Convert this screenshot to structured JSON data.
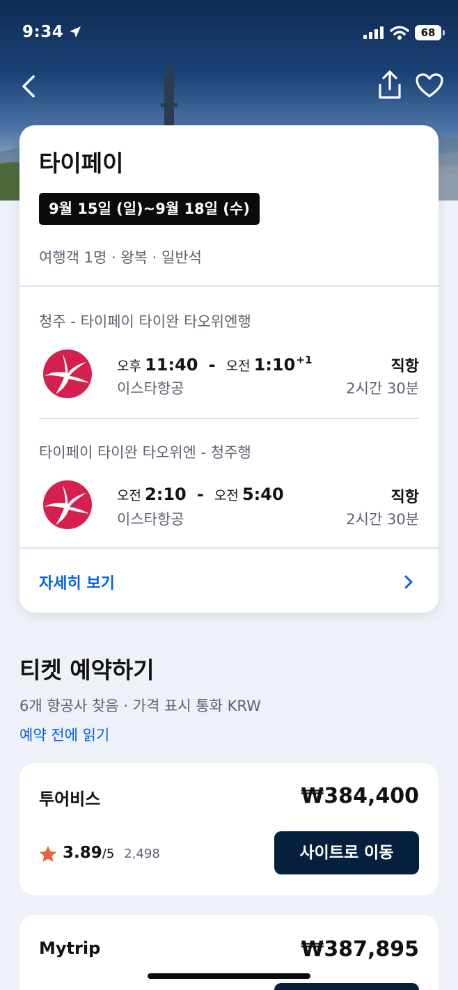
{
  "status_bar": {
    "time": "9:34",
    "battery": "68"
  },
  "trip": {
    "title": "타이페이",
    "dates": "9월 15일 (일)~9월 18일 (수)",
    "meta": "여행객 1명 · 왕복 · 일반석",
    "legs": [
      {
        "route": "청주 - 타이페이 타이완 타오위엔행",
        "dep_ampm": "오후",
        "dep_time": "11:40",
        "arr_ampm": "오전",
        "arr_time": "1:10",
        "arr_day_offset": "+1",
        "separator": "-",
        "airline": "이스타항공",
        "stops": "직항",
        "duration": "2시간 30분"
      },
      {
        "route": "타이페이 타이완 타오위엔 - 청주행",
        "dep_ampm": "오전",
        "dep_time": "2:10",
        "arr_ampm": "오전",
        "arr_time": "5:40",
        "arr_day_offset": "",
        "separator": "-",
        "airline": "이스타항공",
        "stops": "직항",
        "duration": "2시간 30분"
      }
    ],
    "details_label": "자세히 보기"
  },
  "booking": {
    "title": "티켓 예약하기",
    "meta": "6개 항공사 찾음 · 가격 표시 통화 KRW",
    "read_link": "예약 전에 읽기",
    "offers": [
      {
        "name": "투어비스",
        "price": "₩384,400",
        "rating": "3.89",
        "rating_max": "/5",
        "reviews": "2,498",
        "button": "사이트로 이동"
      },
      {
        "name": "Mytrip",
        "price": "₩387,895"
      }
    ]
  },
  "colors": {
    "accent": "#0062e3",
    "button_bg": "#05203c",
    "airline_logo": "#d3204f",
    "star": "#e8603c",
    "chip_bg": "#0b0b0b"
  },
  "icons": {
    "back": "chevron-left-icon",
    "share": "share-icon",
    "favorite": "heart-icon",
    "details": "chevron-right-icon",
    "rating": "star-icon",
    "airline": "eastar-jet-logo"
  }
}
